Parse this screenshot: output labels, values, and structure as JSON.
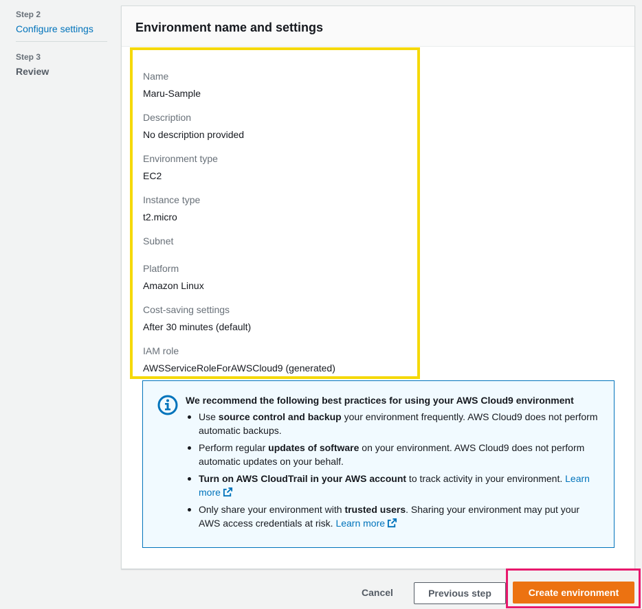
{
  "steps": [
    {
      "num": "Step 2",
      "label": "Configure settings"
    },
    {
      "num": "Step 3",
      "label": "Review"
    }
  ],
  "panel": {
    "title": "Environment name and settings",
    "fields": [
      {
        "key": "Name",
        "value": "Maru-Sample"
      },
      {
        "key": "Description",
        "value": "No description provided"
      },
      {
        "key": "Environment type",
        "value": "EC2"
      },
      {
        "key": "Instance type",
        "value": "t2.micro"
      },
      {
        "key": "Subnet",
        "value": ""
      },
      {
        "key": "Platform",
        "value": "Amazon Linux"
      },
      {
        "key": "Cost-saving settings",
        "value": "After 30 minutes (default)"
      },
      {
        "key": "IAM role",
        "value": "AWSServiceRoleForAWSCloud9 (generated)"
      }
    ]
  },
  "alert": {
    "icon": "info-icon",
    "title": "We recommend the following best practices for using your AWS Cloud9 environment",
    "b1_pre": "Use ",
    "b1_bold": "source control and backup",
    "b1_post": " your environment frequently. AWS Cloud9 does not perform automatic backups.",
    "b2_pre": "Perform regular ",
    "b2_bold": "updates of software",
    "b2_post": " on your environment. AWS Cloud9 does not perform automatic updates on your behalf.",
    "b3_bold": "Turn on AWS CloudTrail in your AWS account",
    "b3_post": " to track activity in your environment. ",
    "b3_link": "Learn more",
    "b4_pre": "Only share your environment with ",
    "b4_bold": "trusted users",
    "b4_post": ". Sharing your environment may put your AWS access credentials at risk. ",
    "b4_link": "Learn more"
  },
  "footer": {
    "cancel": "Cancel",
    "previous": "Previous step",
    "create": "Create environment"
  },
  "colors": {
    "accent": "#ec7211",
    "link": "#0073bb",
    "highlight_yellow": "#f5d90a",
    "highlight_pink": "#e8186c"
  }
}
